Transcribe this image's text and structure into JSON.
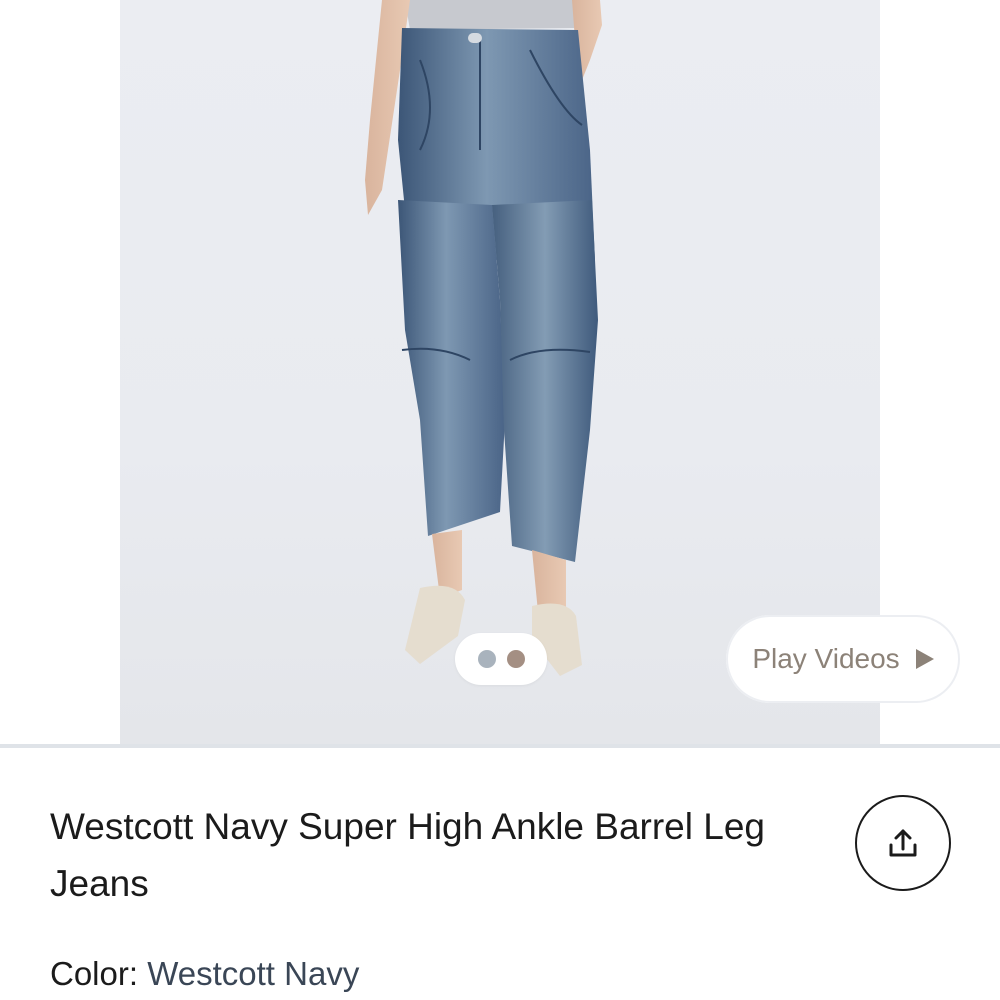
{
  "gallery": {
    "image_alt": "Model wearing barrel leg jeans",
    "dots": [
      {
        "color": "#a9b3bd",
        "active": true
      },
      {
        "color": "#a48f83",
        "active": false
      }
    ],
    "play_videos_label": "Play Videos",
    "play_icon": "play-triangle-icon"
  },
  "product": {
    "title": "Westcott Navy Super High Ankle Barrel Leg Jeans",
    "share_icon": "share-icon",
    "color_label": "Color:",
    "color_value": "Westcott Navy"
  },
  "colors": {
    "denim": "#4d6b8e",
    "text": "#1b1b1b",
    "accent_text": "#8c8278"
  }
}
